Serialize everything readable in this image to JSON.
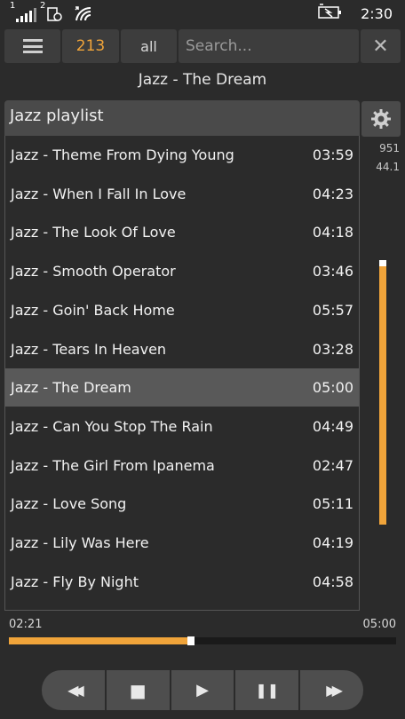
{
  "status": {
    "sim1": "1",
    "sim2": "2",
    "time": "2:30"
  },
  "toolbar": {
    "count": "213",
    "filter": "all",
    "search_placeholder": "Search...",
    "close_glyph": "✕"
  },
  "now_playing": {
    "title": "Jazz - The Dream"
  },
  "playlist": {
    "name": "Jazz playlist",
    "tracks": [
      {
        "title": "Jazz - Theme From Dying Young",
        "duration": "03:59"
      },
      {
        "title": "Jazz - When I Fall In Love",
        "duration": "04:23"
      },
      {
        "title": "Jazz - The Look Of Love",
        "duration": "04:18"
      },
      {
        "title": "Jazz - Smooth Operator",
        "duration": "03:46"
      },
      {
        "title": "Jazz - Goin' Back Home",
        "duration": "05:57"
      },
      {
        "title": "Jazz - Tears In Heaven",
        "duration": "03:28"
      },
      {
        "title": "Jazz - The Dream",
        "duration": "05:00",
        "active": true
      },
      {
        "title": "Jazz - Can You Stop The Rain",
        "duration": "04:49"
      },
      {
        "title": "Jazz - The Girl From Ipanema",
        "duration": "02:47"
      },
      {
        "title": "Jazz - Love Song",
        "duration": "05:11"
      },
      {
        "title": "Jazz - Lily Was Here",
        "duration": "04:19"
      },
      {
        "title": "Jazz - Fly By Night",
        "duration": "04:58"
      }
    ]
  },
  "info": {
    "bitrate": "951",
    "samplerate": "44.1"
  },
  "volume": {
    "level": 0.98
  },
  "progress": {
    "current": "02:21",
    "total": "05:00",
    "fraction": 0.47
  },
  "transport": {
    "prev": "◀◀",
    "stop": "■",
    "play": "▶",
    "pause": "❚❚",
    "next": "▶▶"
  },
  "colors": {
    "accent": "#f0a43a",
    "background": "#2b2b2b",
    "active_row": "#595959"
  }
}
